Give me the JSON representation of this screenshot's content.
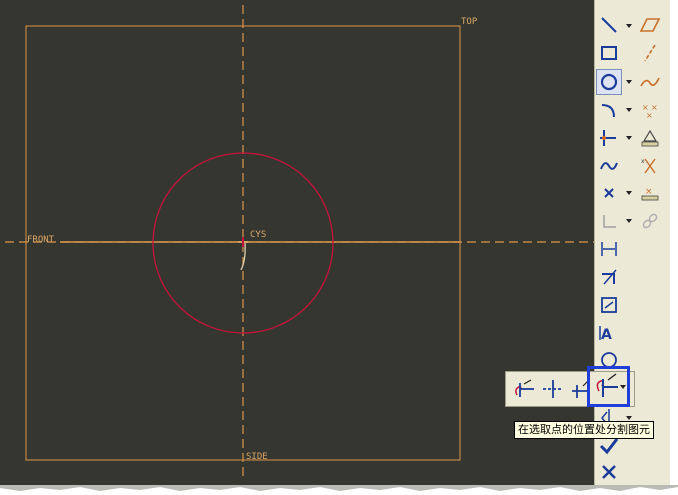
{
  "canvas": {
    "labels": {
      "top": "TOP",
      "front": "FRONT",
      "side": "SIDE",
      "csys": "CYS"
    },
    "colors": {
      "background": "#363630",
      "datum": "#d8974a",
      "circle": "#c4143c"
    }
  },
  "toolbar": {
    "items": [
      {
        "name": "line",
        "icon": "line-icon"
      },
      {
        "name": "rectangle",
        "icon": "rectangle-icon"
      },
      {
        "name": "circle",
        "icon": "circle-icon",
        "active": true
      },
      {
        "name": "arc",
        "icon": "arc-icon"
      },
      {
        "name": "fillet",
        "icon": "fillet-icon"
      },
      {
        "name": "spline",
        "icon": "spline-icon"
      },
      {
        "name": "point",
        "icon": "point-icon"
      },
      {
        "name": "coordinate-system",
        "icon": "coordinate-system-icon"
      },
      {
        "name": "dimension",
        "icon": "dimension-icon"
      },
      {
        "name": "modify",
        "icon": "modify-icon"
      },
      {
        "name": "constraint",
        "icon": "constraint-icon"
      },
      {
        "name": "text",
        "icon": "text-icon"
      },
      {
        "name": "palette",
        "icon": "palette-icon"
      },
      {
        "name": "trim",
        "icon": "trim-icon"
      },
      {
        "name": "mirror",
        "icon": "mirror-icon"
      },
      {
        "name": "accept",
        "icon": "checkmark-icon"
      },
      {
        "name": "cancel",
        "icon": "cancel-icon"
      }
    ],
    "secondary": [
      {
        "name": "parallelogram",
        "icon": "parallelogram-icon"
      },
      {
        "name": "centerline",
        "icon": "centerline-icon"
      },
      {
        "name": "spline-sketch",
        "icon": "spline-curve-icon"
      },
      {
        "name": "x-points",
        "icon": "x-points-icon"
      },
      {
        "name": "measure",
        "icon": "measure-icon"
      },
      {
        "name": "intersect",
        "icon": "intersect-icon"
      },
      {
        "name": "sketch-point",
        "icon": "sketch-point-icon"
      },
      {
        "name": "chain",
        "icon": "chain-icon"
      }
    ]
  },
  "flyout": {
    "items": [
      {
        "name": "dynamic-trim",
        "icon": "dynamic-trim-icon"
      },
      {
        "name": "corner-trim",
        "icon": "corner-trim-icon"
      },
      {
        "name": "divide",
        "icon": "divide-icon"
      },
      {
        "name": "divide-at-point",
        "icon": "divide-at-point-icon",
        "selected": true
      }
    ],
    "tooltip": "在选取点的位置处分割图元"
  }
}
